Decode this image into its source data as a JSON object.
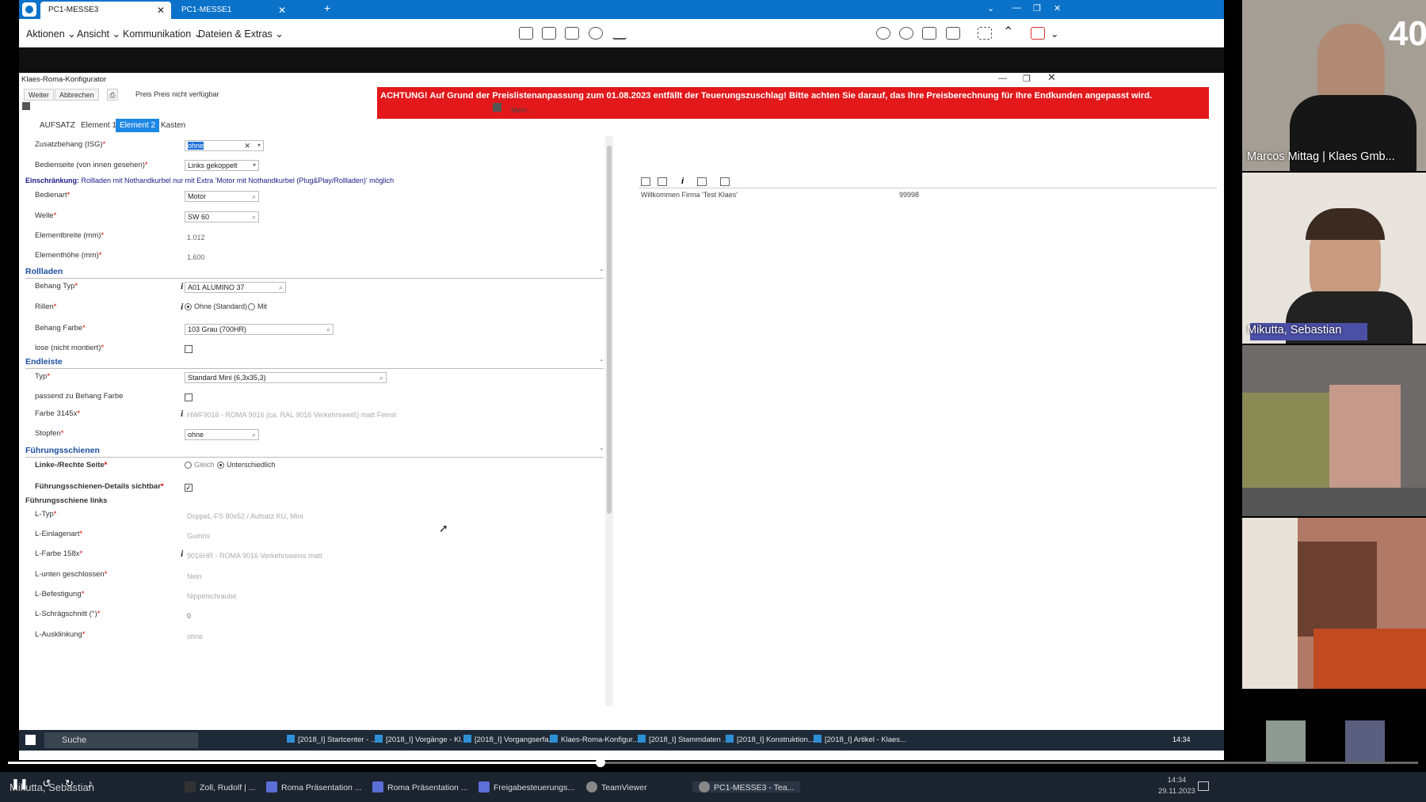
{
  "remote": {
    "tabs": [
      {
        "label": "PC1-MESSE3"
      },
      {
        "label": "PC1-MESSE1"
      }
    ],
    "menu": [
      "Aktionen",
      "Ansicht",
      "Kommunikation",
      "Dateien & Extras"
    ],
    "toolbar_icons": [
      "statistics-icon",
      "remote-keyboard-icon",
      "file-transfer-icon",
      "record-icon",
      "download-icon"
    ],
    "right_icons": [
      "chat-icon",
      "call-icon",
      "whiteboard-icon",
      "screenshot-icon",
      "fullscreen-icon",
      "collapse-icon",
      "end-session-icon"
    ]
  },
  "configurator": {
    "title": "Klaes-Roma-Konfigurator",
    "buttons": {
      "weiter": "Weiter",
      "abbrechen": "Abbrechen"
    },
    "price_text": "Preis Preis nicht verfügbar",
    "alert": "ACHTUNG! Auf Grund der Preislistenanpassung zum 01.08.2023 entfällt der Teuerungszuschlag! Bitte achten Sie darauf, das Ihre Preisberechnung für Ihre Endkunden angepasst wird.",
    "tabs": [
      "AUFSATZ",
      "Element 1",
      "Element 2",
      "Kasten"
    ],
    "more_label": "Mehr...",
    "welcome": "Willkommen Firma 'Test Klaes'",
    "welcome_num": "99998",
    "required_mark": "*",
    "fields": {
      "zusatzbehang": {
        "label": "Zusatzbehang (ISG)",
        "value": "ohne"
      },
      "bedienseite": {
        "label": "Bedienseite (von innen gesehen)",
        "value": "Links gekoppelt"
      },
      "einschraenkung_label": "Einschränkung:",
      "einschraenkung_text": "Rollladen mit Nothandkurbel nur mit Extra 'Motor mit Nothandkurbel (Plug&Play/Rollladen)' möglich",
      "bedienart": {
        "label": "Bedienart",
        "value": "Motor"
      },
      "welle": {
        "label": "Welle",
        "value": "SW 60"
      },
      "elementbreite": {
        "label": "Elementbreite (mm)",
        "value": "1.012"
      },
      "elementhoehe": {
        "label": "Elementhöhe (mm)",
        "value": "1.600"
      }
    },
    "sections": {
      "rollladen": "Rollladen",
      "endleiste": "Endleiste",
      "fuehrungsschienen": "Führungsschienen",
      "fs_links": "Führungsschiene links"
    },
    "rollladen": {
      "behang_typ": {
        "label": "Behang Typ",
        "value": "A01   ALUMINO 37"
      },
      "rillen": {
        "label": "Rillen",
        "opt1": "Ohne (Standard)",
        "opt2": "Mit"
      },
      "behang_farbe": {
        "label": "Behang Farbe",
        "value": "103 Grau (700HR)"
      },
      "lose": {
        "label": "lose (nicht montiert)"
      }
    },
    "endleiste": {
      "typ": {
        "label": "Typ",
        "value": "Standard Mini (6,3x35,3)"
      },
      "passend": {
        "label": "passend zu Behang Farbe"
      },
      "farbe": {
        "label": "Farbe 3145x",
        "value": "HWF9016 - ROMA  9016 (ca. RAL 9016 Verkehrsweiß) matt Feinst"
      },
      "stopfen": {
        "label": "Stopfen",
        "value": "ohne"
      }
    },
    "fuehrung": {
      "seite": {
        "label": "Linke-/Rechte Seite",
        "opt1": "Gleich",
        "opt2": "Unterschiedlich"
      },
      "details": {
        "label": "Führungsschienen-Details sichtbar"
      },
      "l_typ": {
        "label": "L-Typ",
        "value": "DoppeL-FS 80x52 / Aufsatz KU, Mini"
      },
      "l_einlage": {
        "label": "L-Einlagenart",
        "value": "Gummi"
      },
      "l_farbe": {
        "label": "L-Farbe 158x",
        "value": "9016HR - ROMA 9016 Verkehrsweiss matt"
      },
      "l_unten": {
        "label": "L-unten geschlossen",
        "value": "Nein"
      },
      "l_befestigung": {
        "label": "L-Befestigung",
        "value": "Nippelschraube"
      },
      "l_schraeg": {
        "label": "L-Schrägschnitt (°)",
        "value": "0"
      },
      "l_ausklinkung": {
        "label": "L-Ausklinkung",
        "value": "ohne"
      }
    }
  },
  "win_taskbar": {
    "search": "Suche",
    "items": [
      "[2018_I] Startcenter - ...",
      "[2018_I] Vorgänge - Kl...",
      "[2018_I] Vorgangserfa...",
      "Klaes-Roma-Konfigur...",
      "[2018_I] Stammdaten ...",
      "[2018_I] Konstruktion...",
      "[2018_I] Artikel - Klaes..."
    ],
    "time": "14:34"
  },
  "video": {
    "progress": 0.42
  },
  "host_taskbar": {
    "speaker": "Mikutta, Sebastian",
    "items": [
      "Zoll, Rudolf | ...",
      "Roma Präsentation ...",
      "Roma Präsentation ...",
      "Freigabesteuerungs...",
      "TeamViewer",
      "PC1-MESSE3 - Tea..."
    ],
    "time": "14:34",
    "date": "29.11.2023"
  },
  "participants": [
    {
      "name": "Marcos Mittag | Klaes Gmb...",
      "overlay": "40"
    },
    {
      "name": "Mikutta, Sebastian"
    }
  ]
}
